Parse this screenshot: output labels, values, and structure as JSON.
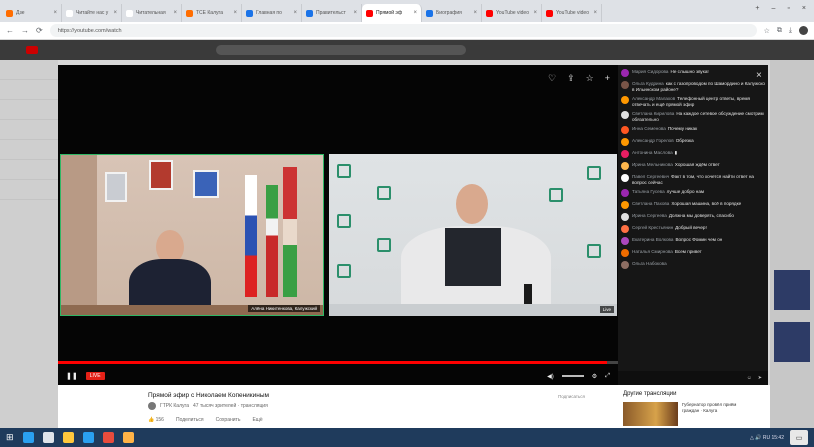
{
  "browser": {
    "tabs": [
      {
        "label": "Дзе",
        "color": "#ff6d00",
        "active": false
      },
      {
        "label": "Читайте нас у",
        "color": "#ffffff",
        "active": false
      },
      {
        "label": "Читательная",
        "color": "#ffffff",
        "active": false
      },
      {
        "label": "ТСЕ Калуга",
        "color": "#ff6d00",
        "active": false
      },
      {
        "label": "Главная по",
        "color": "#1a73e8",
        "active": false
      },
      {
        "label": "Правительст",
        "color": "#1a73e8",
        "active": false
      },
      {
        "label": "Прямой эф",
        "color": "#ff0000",
        "active": true
      },
      {
        "label": "Биография",
        "color": "#1a73e8",
        "active": false
      },
      {
        "label": "YouTube video",
        "color": "#ff0000",
        "active": false
      },
      {
        "label": "YouTube video",
        "color": "#ff0000",
        "active": false
      }
    ],
    "window_controls": [
      "+",
      "–",
      "▫",
      "×"
    ],
    "url": "https://youtube.com/watch",
    "nav": [
      "←",
      "→",
      "⟳"
    ]
  },
  "player": {
    "top_icons": [
      "♡",
      "⇪",
      "☆",
      "+"
    ],
    "left_caption": "Алёна Никитенкова, Калужский",
    "right_caption": "Live",
    "live_label": "LIVE",
    "settings_icon": "⚙",
    "fullscreen_icon": "⤢",
    "progress_percent": 98
  },
  "chat": {
    "messages": [
      {
        "author": "Мария Сидорова",
        "text": "Не слышно звука!",
        "color": "#9c27b0"
      },
      {
        "author": "Ольга Кудрина",
        "text": "как с газопроводом по Шамордино и Калужско в Ильинском районе?",
        "color": "#795548"
      },
      {
        "author": "Александр Малахов",
        "text": "Телефонный центр ответы, время отвечать и ещё прямой эфир",
        "color": "#ff9800"
      },
      {
        "author": "Светлана Кирилова",
        "text": "На каждое сетевое обсуждение смотрим обязательно",
        "color": "#e0e0e0"
      },
      {
        "author": "Инна Семенова",
        "text": "Почему никак",
        "color": "#ff5722"
      },
      {
        "author": "Александр Горелов",
        "text": "Обрезка",
        "color": "#ff9800"
      },
      {
        "author": "Антонина Маслова",
        "text": "▮",
        "color": "#e91e63"
      },
      {
        "author": "Ирина Мельникова",
        "text": "Хорошая ждём ответ",
        "color": "#ffb74d"
      },
      {
        "author": "Павел Сергеевич",
        "text": "Факт в том, что хочется найти ответ на вопрос сейчас",
        "color": "#ffffff"
      },
      {
        "author": "Татьяна Гусева",
        "text": "лучше добро нам",
        "color": "#9c27b0"
      },
      {
        "author": "Светлана Пахова",
        "text": "Хорошая машина, всё в порядке",
        "color": "#ff9800"
      },
      {
        "author": "Ирина Сергеева",
        "text": "Должна мы доверять, спасибо",
        "color": "#e0e0e0"
      },
      {
        "author": "Сергей Крестьянин",
        "text": "Добрый вечер!",
        "color": "#ff7043"
      },
      {
        "author": "Екатерина Волкова",
        "text": "Вопрос Фомин чем он",
        "color": "#ab47bc"
      },
      {
        "author": "Наталья Смирнова",
        "text": "Всем привет",
        "color": "#ef6c00"
      },
      {
        "author": "Ольга Набокова",
        "text": "",
        "color": "#8d6e63"
      }
    ],
    "close_icon": "×",
    "send_icon": "➤"
  },
  "video": {
    "title": "Прямой эфир с Николаем Копеникиным",
    "channel": "ГТРК Калуга",
    "channel_meta": "47 тысяч зрителей · трансляция",
    "actions": [
      "👍 156",
      "Поделиться",
      "Сохранить",
      "Ещё"
    ],
    "more_title": "Другие трансляции",
    "more_text": "Губернатор провёл приём граждан · Калуга",
    "subscribe_hint": "Подписаться"
  },
  "taskbar": {
    "icons": [
      "#2aa0f0",
      "#dfe4ea",
      "#ffc83d",
      "#2aa0f0",
      "#e84c3d",
      "#ffb347"
    ],
    "tray_text": "△ 🔊 RU 15:42",
    "notify_icon": "▭"
  }
}
